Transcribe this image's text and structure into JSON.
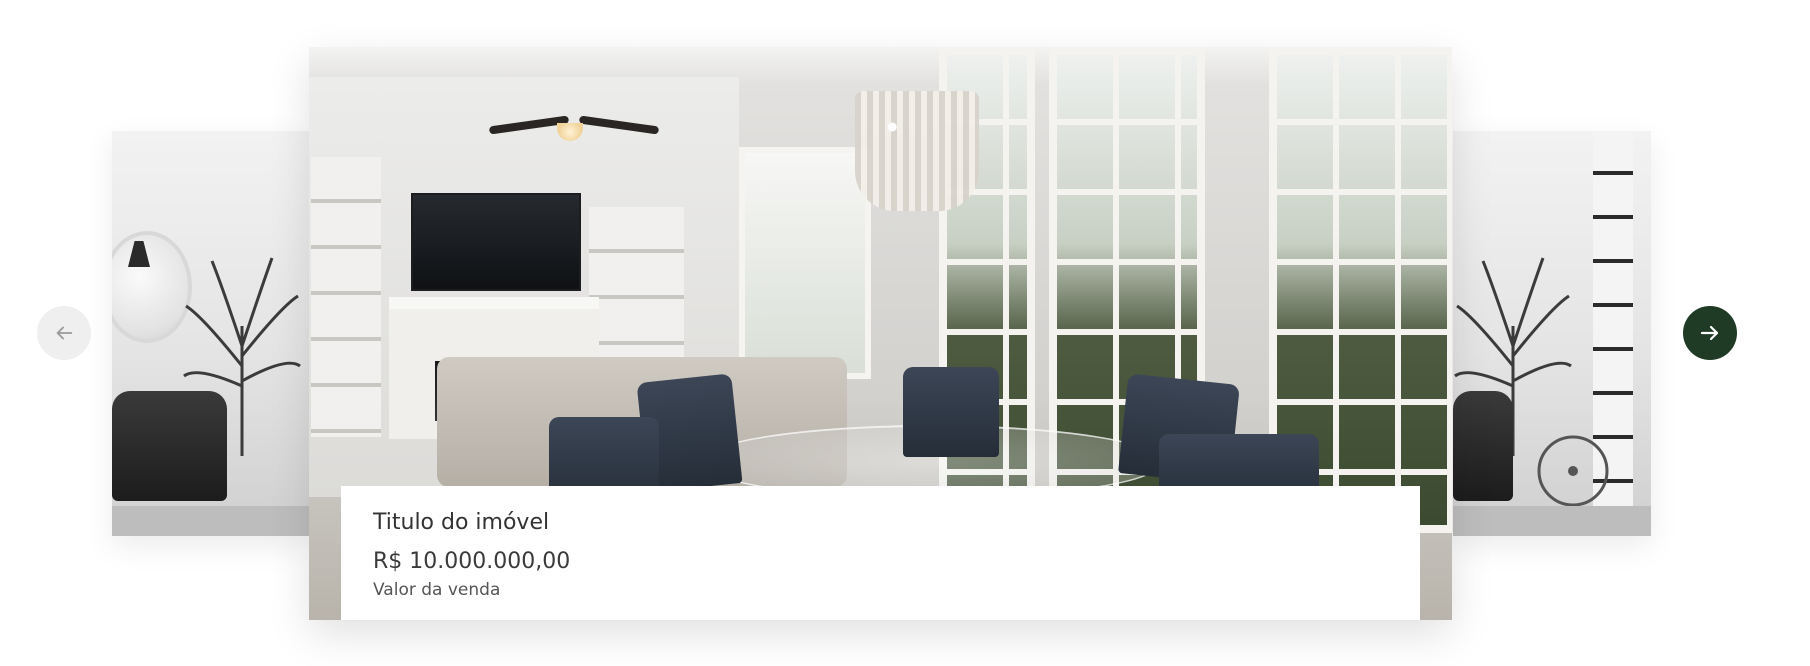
{
  "carousel": {
    "prev_icon": "arrow-left-icon",
    "next_icon": "arrow-right-icon",
    "colors": {
      "prev_button_bg": "#efefef",
      "next_button_bg": "#1f3b25",
      "prev_icon": "#9a9a9a",
      "next_icon": "#ffffff"
    }
  },
  "property": {
    "title": "Titulo do imóvel",
    "price": "R$ 10.000.000,00",
    "price_label": "Valor da venda"
  }
}
